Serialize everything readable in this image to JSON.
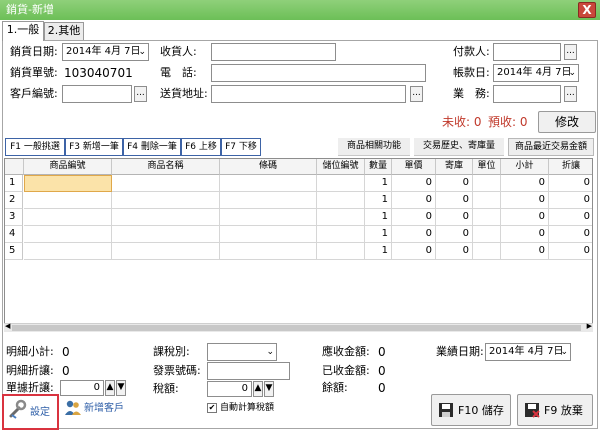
{
  "window": {
    "title": "銷貨-新增",
    "close_glyph": "X"
  },
  "tabs": [
    {
      "label": "1.一般"
    },
    {
      "label": "2.其他"
    }
  ],
  "form": {
    "sale_date_label": "銷貨日期:",
    "sale_date_value": "2014年 4月 7日",
    "sale_no_label": "銷貨單號:",
    "sale_no_value": "103040701",
    "customer_no_label": "客戶編號:",
    "customer_no_value": "",
    "receiver_label": "收貨人:",
    "receiver_value": "",
    "phone_label": "電　話:",
    "phone_value": "",
    "address_label": "送貨地址:",
    "address_value": "",
    "payer_label": "付款人:",
    "payer_value": "",
    "account_date_label": "帳款日:",
    "account_date_value": "2014年 4月 7日",
    "sales_label": "業　務:",
    "sales_value": "",
    "browse_glyph": "...",
    "dropdown_glyph": "⌄"
  },
  "status": {
    "unreceived_label": "未收:",
    "unreceived_value": "0",
    "prereceived_label": "預收:",
    "prereceived_value": "0",
    "modify_button": "修改"
  },
  "toolbar": {
    "buttons": [
      {
        "label": "F1 一般挑選"
      },
      {
        "label": "F3 新增一筆"
      },
      {
        "label": "F4 刪除一筆"
      },
      {
        "label": "F6 上移"
      },
      {
        "label": "F7 下移"
      }
    ],
    "functions": [
      {
        "label": "商品相關功能"
      },
      {
        "label": "交易歷史、寄庫量"
      },
      {
        "label": "商品最近交易金額"
      }
    ]
  },
  "grid": {
    "columns": [
      "商品編號",
      "商品名稱",
      "條碼",
      "儲位編號",
      "數量",
      "單價",
      "寄庫",
      "單位",
      "小計",
      "折讓"
    ],
    "rows": [
      {
        "no": "1",
        "qty": "1",
        "price": "0",
        "consign": "0",
        "subtotal": "0",
        "discount": "0"
      },
      {
        "no": "2",
        "qty": "1",
        "price": "0",
        "consign": "0",
        "subtotal": "0",
        "discount": "0"
      },
      {
        "no": "3",
        "qty": "1",
        "price": "0",
        "consign": "0",
        "subtotal": "0",
        "discount": "0"
      },
      {
        "no": "4",
        "qty": "1",
        "price": "0",
        "consign": "0",
        "subtotal": "0",
        "discount": "0"
      },
      {
        "no": "5",
        "qty": "1",
        "price": "0",
        "consign": "0",
        "subtotal": "0",
        "discount": "0"
      }
    ]
  },
  "summary": {
    "detail_subtotal_label": "明細小計:",
    "detail_subtotal_value": "0",
    "detail_discount_label": "明細折讓:",
    "detail_discount_value": "0",
    "doc_discount_label": "單據折讓:",
    "doc_discount_value": "0",
    "tax_type_label": "課稅別:",
    "tax_type_value": "",
    "invoice_no_label": "發票號碼:",
    "invoice_no_value": "",
    "tax_amount_label": "稅額:",
    "tax_amount_value": "0",
    "receivable_label": "應收金額:",
    "receivable_value": "0",
    "received_label": "已收金額:",
    "received_value": "0",
    "balance_label": "餘額:",
    "balance_value": "0",
    "perf_date_label": "業績日期:",
    "perf_date_value": "2014年 4月 7日",
    "auto_tax_label": "自動計算稅額",
    "auto_tax_checked": "✔",
    "spin_up": "▲",
    "spin_down": "▼"
  },
  "actions": {
    "settings_label": "設定",
    "new_customer_label": "新增客戶",
    "save_label": "F10 儲存",
    "discard_label": "F9 放棄"
  },
  "colors": {
    "title_bar": "#6cbf57",
    "status_text": "#c0392b",
    "highlight_cell": "#fbe3a9",
    "accent_border": "#d9333f"
  }
}
